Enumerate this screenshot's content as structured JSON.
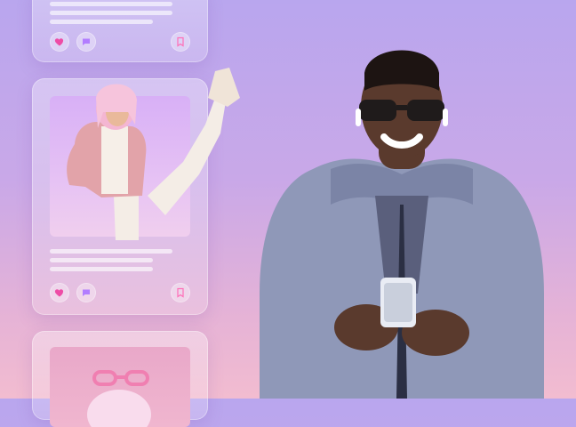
{
  "feed": {
    "cards": [
      {
        "name": "post-card-top",
        "lines": 3,
        "icons": [
          "heart-icon",
          "comment-icon",
          "bookmark-icon"
        ]
      },
      {
        "name": "post-card-featured",
        "lines": 3,
        "icons": [
          "heart-icon",
          "comment-icon",
          "bookmark-icon"
        ]
      },
      {
        "name": "post-card-bottom",
        "lines": 0,
        "icons": []
      }
    ]
  },
  "colors": {
    "background_top": "#b9a6ee",
    "background_bottom": "#f2bcd0",
    "heart": "#ee4ca6",
    "comment": "#b27dff",
    "bookmark": "#ff6fb7",
    "hoodie": "#8f98b8",
    "hair": "#f4b6d2"
  }
}
